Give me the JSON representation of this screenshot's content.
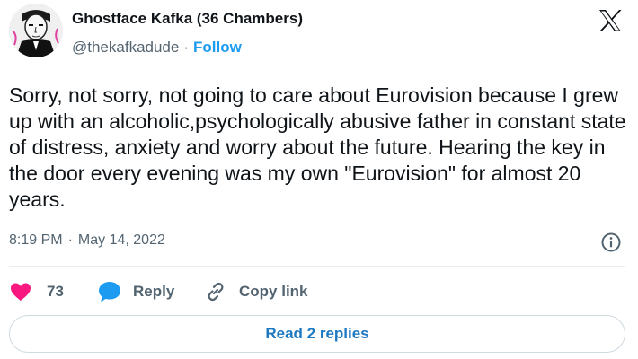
{
  "author": {
    "display_name": "Ghostface Kafka (36 Chambers)",
    "handle": "@thekafkadude",
    "separator": "·",
    "follow_label": "Follow",
    "avatar_icon": "kafka-portrait-avatar"
  },
  "brand": {
    "logo_icon": "x-logo-icon"
  },
  "tweet": {
    "text": "Sorry, not sorry, not going to care about Eurovision because I grew up with an alcoholic,psychologically abusive father in constant state of distress, anxiety and worry about the future. Hearing the key in the door every evening was my own \"Eurovision\" for almost 20 years.",
    "time": "8:19 PM",
    "separator": "·",
    "date": "May 14, 2022"
  },
  "actions": {
    "like_count": "73",
    "reply_label": "Reply",
    "copy_link_label": "Copy link"
  },
  "footer": {
    "read_replies_label": "Read 2 replies"
  },
  "colors": {
    "text": "#0f1419",
    "secondary": "#536471",
    "accent": "#1d9bf0",
    "like": "#f91880",
    "border": "#cfd9de"
  }
}
